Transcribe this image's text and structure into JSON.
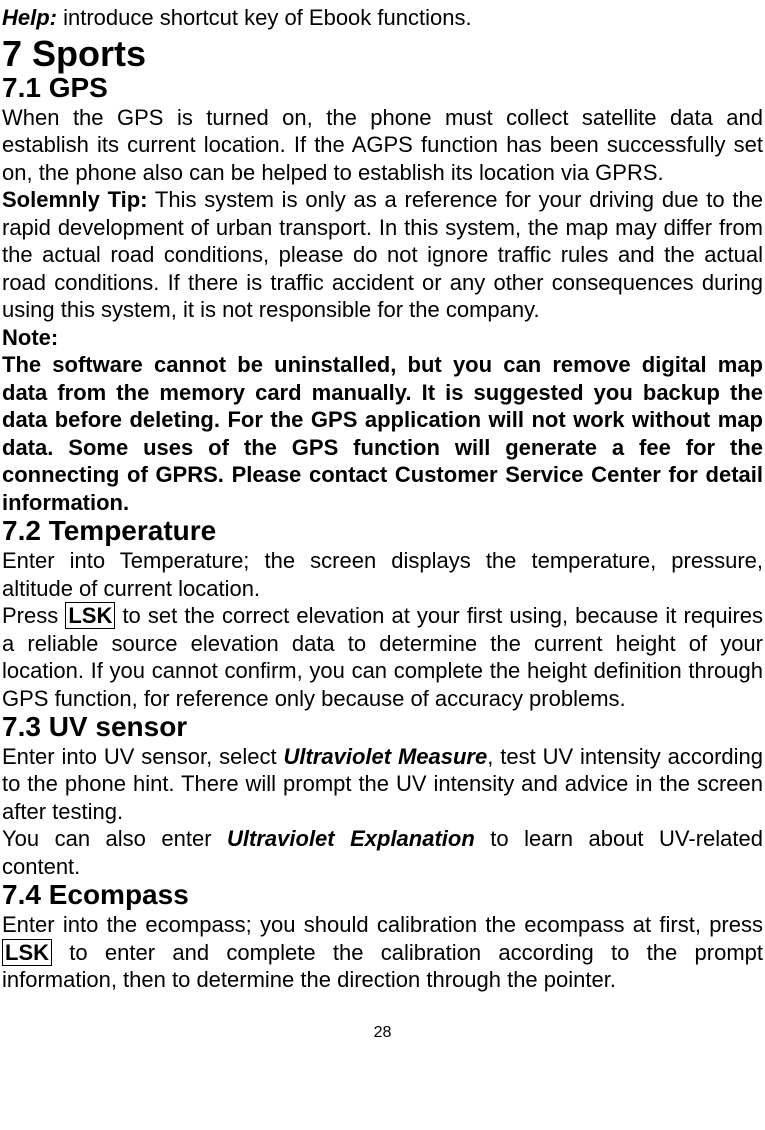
{
  "help_label": "Help:",
  "help_text": " introduce shortcut key of Ebook functions.",
  "h1": "7  Sports",
  "s71": {
    "heading": "7.1  GPS",
    "p1": "When the GPS is turned on, the phone must collect satellite data and establish its current location. If the AGPS function has been successfully set on, the phone also can be helped to establish its location via GPRS.",
    "tip_label": "Solemnly Tip:",
    "tip_text": " This system is only as a reference for your driving due to the rapid development of urban transport. In this system, the map may differ from the actual road conditions, please do not ignore traffic rules and the actual road conditions. If there is traffic accident or any other consequences during using this system, it is not responsible for the company.",
    "note_label": "Note:",
    "note_text": "The software cannot be uninstalled, but you can remove digital map data from the memory card manually. It is suggested you backup the data before deleting. For the GPS application will not work without map data. Some uses of the GPS function will generate a fee for the connecting of GPRS. Please contact Customer Service Center for detail information."
  },
  "s72": {
    "heading": "7.2  Temperature",
    "p1": "Enter into Temperature; the screen displays the temperature, pressure, altitude of current location.",
    "p2a": "Press ",
    "lsk": "LSK",
    "p2b": " to set the correct elevation at your first using, because it requires a reliable source elevation data to determine the current height of your location. If you cannot confirm, you can complete the height definition through GPS function, for reference only because of accuracy problems."
  },
  "s73": {
    "heading": "7.3  UV sensor",
    "p1a": "Enter into UV sensor, select ",
    "p1b": "Ultraviolet Measure",
    "p1c": ", test UV intensity according to the phone hint. There will prompt the UV intensity and advice in the screen after testing.",
    "p2a": "You can also enter ",
    "p2b": "Ultraviolet Explanation",
    "p2c": " to learn about UV-related content."
  },
  "s74": {
    "heading": "7.4  Ecompass",
    "p1a": "Enter into the ecompass; you should calibration the ecompass at first, press ",
    "lsk": "LSK",
    "p1b": " to enter and complete the calibration according to the prompt information, then to determine the direction through the pointer."
  },
  "page_number": "28"
}
